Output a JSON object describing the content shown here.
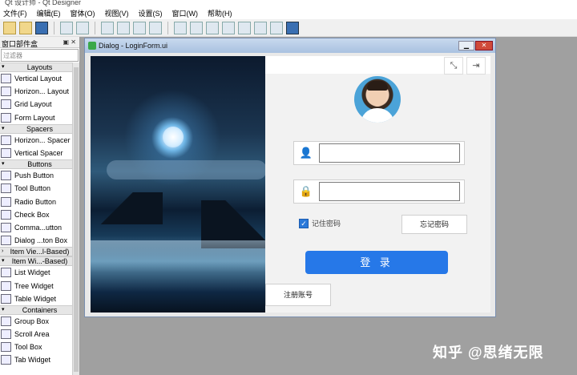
{
  "app": {
    "title": "Qt 设计师 - Qt Designer"
  },
  "menu": [
    "文件(F)",
    "编辑(E)",
    "窗体(O)",
    "视图(V)",
    "设置(S)",
    "窗口(W)",
    "帮助(H)"
  ],
  "widget_box": {
    "title": "窗口部件盒",
    "filter_placeholder": "过滤器",
    "sections": [
      {
        "name": "Layouts",
        "items": [
          "Vertical Layout",
          "Horizon... Layout",
          "Grid Layout",
          "Form Layout"
        ]
      },
      {
        "name": "Spacers",
        "items": [
          "Horizon... Spacer",
          "Vertical Spacer"
        ]
      },
      {
        "name": "Buttons",
        "items": [
          "Push Button",
          "Tool Button",
          "Radio Button",
          "Check Box",
          "Comma...utton",
          "Dialog ...ton Box"
        ]
      },
      {
        "name": "Item Vie...l-Based)",
        "items": []
      },
      {
        "name": "Item Wi...-Based)",
        "items": [
          "List Widget",
          "Tree Widget",
          "Table Widget"
        ]
      },
      {
        "name": "Containers",
        "items": [
          "Group Box",
          "Scroll Area",
          "Tool Box",
          "Tab Widget"
        ]
      }
    ]
  },
  "dialog": {
    "title": "Dialog - LoginForm.ui",
    "remember_label": "记住密码",
    "forgot_label": "忘记密码",
    "login_label": "登 录",
    "register_label": "注册账号",
    "username_value": "",
    "password_value": ""
  },
  "icons": {
    "user": "user-icon",
    "lock": "lock-icon",
    "shrink": "shrink-icon",
    "exit": "exit-icon"
  },
  "watermark": "知乎 @思绪无限",
  "colors": {
    "login_button": "#2678e8",
    "checkbox": "#2b79d9"
  }
}
